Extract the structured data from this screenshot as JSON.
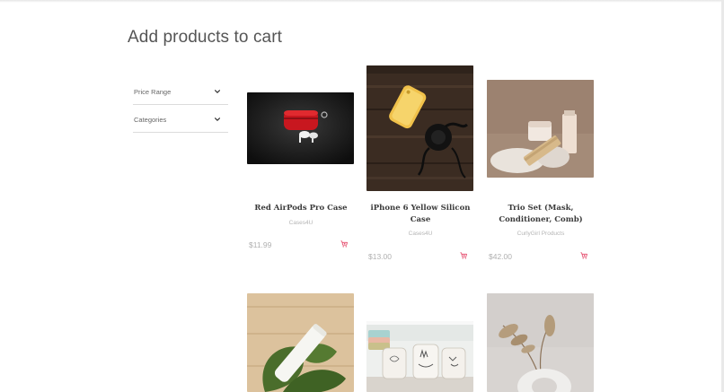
{
  "page": {
    "title": "Add products to cart"
  },
  "filters": [
    {
      "label": "Price Range",
      "icon": "chevron-down-icon"
    },
    {
      "label": "Categories",
      "icon": "chevron-down-icon"
    }
  ],
  "products": [
    {
      "name": "Red AirPods Pro Case",
      "brand": "Cases4U",
      "price": "$11.99",
      "image": "red-airpods-case-photo"
    },
    {
      "name": "iPhone 6 Yellow Silicon Case",
      "brand": "Cases4U",
      "price": "$13.00",
      "image": "yellow-iphone-case-photo"
    },
    {
      "name": "Trio Set (Mask, Conditioner, Comb)",
      "brand": "CurlyGirl Products",
      "price": "$42.00",
      "image": "cosmetics-trio-photo"
    },
    {
      "name": "",
      "brand": "",
      "price": "",
      "image": "white-tube-on-leaves-photo"
    },
    {
      "name": "",
      "brand": "",
      "price": "",
      "image": "bunny-mugs-photo"
    },
    {
      "name": "",
      "brand": "",
      "price": "",
      "image": "pampas-grass-vase-photo"
    }
  ],
  "colors": {
    "cart_icon": "#e0284f",
    "title": "#555555"
  }
}
